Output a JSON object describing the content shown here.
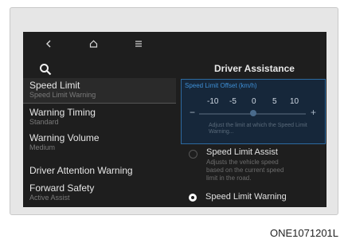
{
  "nav": {
    "back_icon": "chevron-left-icon",
    "home_icon": "home-icon",
    "menu_icon": "hamburger-menu-icon"
  },
  "search_icon": "search-icon",
  "menu": [
    {
      "label": "Speed Limit",
      "sub": "Speed Limit Warning"
    },
    {
      "label": "Warning Timing",
      "sub": "Standard"
    },
    {
      "label": "Warning Volume",
      "sub": "Medium"
    },
    {
      "label": "Driver Attention Warning",
      "sub": ""
    },
    {
      "label": "Forward Safety",
      "sub": "Active Assist"
    }
  ],
  "panel": {
    "title": "Driver Assistance",
    "offset": {
      "label": "Speed Limit Offset (km/h)",
      "values": [
        "-10",
        "-5",
        "0",
        "5",
        "10"
      ],
      "selected": "0",
      "minus": "−",
      "plus": "+",
      "note": "Adjust the limit at which the Speed Limit Warning..."
    },
    "assist": {
      "name": "Speed Limit Assist",
      "desc": "Adjusts the vehicle speed based on the current speed limit in the road."
    },
    "warning": {
      "name": "Speed Limit Warning",
      "selected": true
    }
  },
  "figure_code": "ONE1071201L"
}
